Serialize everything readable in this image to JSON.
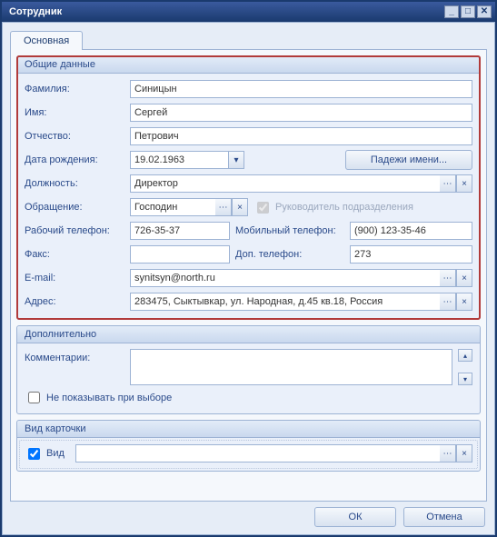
{
  "window": {
    "title": "Сотрудник"
  },
  "tabs": {
    "main": "Основная"
  },
  "group_general": {
    "title": "Общие данные",
    "last_name_label": "Фамилия:",
    "last_name": "Синицын",
    "first_name_label": "Имя:",
    "first_name": "Сергей",
    "middle_name_label": "Отчество:",
    "middle_name": "Петрович",
    "birth_date_label": "Дата рождения:",
    "birth_date": "19.02.1963",
    "name_cases_btn": "Падежи имени...",
    "position_label": "Должность:",
    "position": "Директор",
    "salutation_label": "Обращение:",
    "salutation": "Господин",
    "is_manager_label": "Руководитель подразделения",
    "is_manager_checked": true,
    "work_phone_label": "Рабочий телефон:",
    "work_phone": "726-35-37",
    "mobile_phone_label": "Мобильный телефон:",
    "mobile_phone": "(900) 123-35-46",
    "fax_label": "Факс:",
    "fax": "",
    "extra_phone_label": "Доп. телефон:",
    "extra_phone": "273",
    "email_label": "E-mail:",
    "email": "synitsyn@north.ru",
    "address_label": "Адрес:",
    "address": "283475, Сыктывкар, ул. Народная, д.45 кв.18, Россия"
  },
  "group_additional": {
    "title": "Дополнительно",
    "comments_label": "Комментарии:",
    "comments": "",
    "hide_in_select_label": "Не показывать при выборе",
    "hide_in_select_checked": false
  },
  "group_cardview": {
    "title": "Вид карточки",
    "view_label": "Вид",
    "view_checked": true
  },
  "dialog": {
    "ok": "ОК",
    "cancel": "Отмена"
  }
}
